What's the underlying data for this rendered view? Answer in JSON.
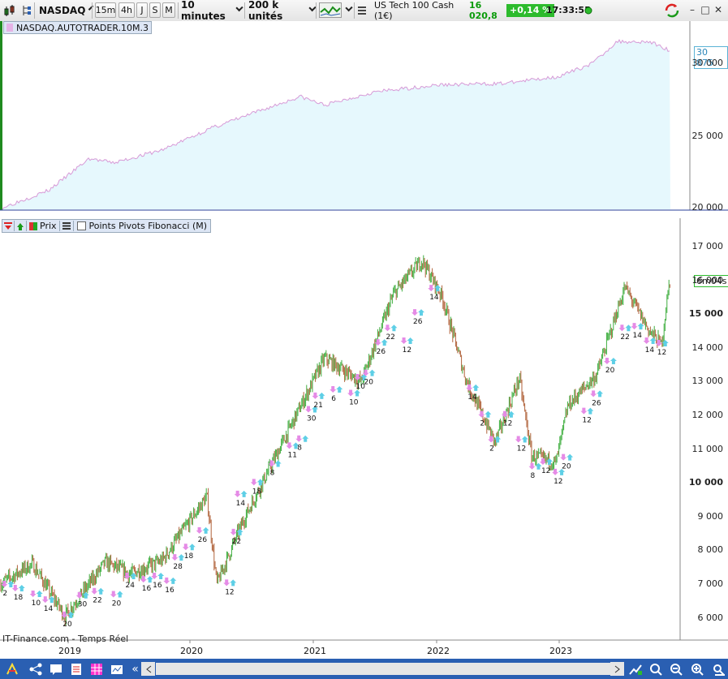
{
  "toolbar": {
    "instrument": "NASDAQ",
    "timeframes": [
      "15m",
      "4h",
      "J",
      "S",
      "M"
    ],
    "period": "10 minutes",
    "units": "200 k unités",
    "quote_name": "US Tech 100 Cash (1€)",
    "quote_price": "16 020,8",
    "quote_change": "+0,14 %",
    "time": "17:33:55",
    "colors": {
      "up": "#2dbb2d",
      "accent": "#2a5fb2"
    }
  },
  "top_panel": {
    "label": "NASDAQ.AUTOTRADER.10M.3",
    "last_value": "30 875",
    "y_ticks": [
      "30 000",
      "25 000",
      "20 000"
    ]
  },
  "main_panel": {
    "controls": {
      "prix": "Prix",
      "indicator": "Points Pivots Fibonacci (M)"
    },
    "countdown": "6m04s",
    "y_ticks": [
      "17 000",
      "16 000",
      "15 000",
      "14 000",
      "13 000",
      "12 000",
      "11 000",
      "10 000",
      "9 000",
      "8 000",
      "7 000",
      "6 000"
    ],
    "x_ticks": [
      "2019",
      "2020",
      "2021",
      "2022",
      "2023"
    ],
    "watermark": "IT-Finance.com - Temps Réel",
    "pivot_labels": [
      {
        "t": "2",
        "x": 0.02,
        "v": 6760
      },
      {
        "t": "18",
        "x": 0.1,
        "v": 6640
      },
      {
        "t": "10",
        "x": 0.23,
        "v": 6470
      },
      {
        "t": "14",
        "x": 0.32,
        "v": 6300
      },
      {
        "t": "20",
        "x": 0.46,
        "v": 5850
      },
      {
        "t": "30",
        "x": 0.57,
        "v": 6430
      },
      {
        "t": "22",
        "x": 0.68,
        "v": 6550
      },
      {
        "t": "20",
        "x": 0.82,
        "v": 6460
      },
      {
        "t": "24",
        "x": 0.92,
        "v": 7000
      },
      {
        "t": "16",
        "x": 1.04,
        "v": 6900
      },
      {
        "t": "16",
        "x": 1.12,
        "v": 7000
      },
      {
        "t": "16",
        "x": 1.21,
        "v": 6860
      },
      {
        "t": "28",
        "x": 1.27,
        "v": 7550
      },
      {
        "t": "18",
        "x": 1.35,
        "v": 7860
      },
      {
        "t": "26",
        "x": 1.45,
        "v": 8350
      },
      {
        "t": "12",
        "x": 1.65,
        "v": 6800
      },
      {
        "t": "22",
        "x": 1.7,
        "v": 8300
      },
      {
        "t": "14",
        "x": 1.73,
        "v": 9430
      },
      {
        "t": "18",
        "x": 1.85,
        "v": 9780
      },
      {
        "t": "8",
        "x": 1.98,
        "v": 10330
      },
      {
        "t": "11",
        "x": 2.11,
        "v": 10860
      },
      {
        "t": "8",
        "x": 2.18,
        "v": 11070
      },
      {
        "t": "30",
        "x": 2.25,
        "v": 11940
      },
      {
        "t": "21",
        "x": 2.3,
        "v": 12340
      },
      {
        "t": "6",
        "x": 2.43,
        "v": 12530
      },
      {
        "t": "10",
        "x": 2.56,
        "v": 12420
      },
      {
        "t": "10",
        "x": 2.61,
        "v": 12890
      },
      {
        "t": "20",
        "x": 2.67,
        "v": 13020
      },
      {
        "t": "26",
        "x": 2.76,
        "v": 13920
      },
      {
        "t": "22",
        "x": 2.83,
        "v": 14350
      },
      {
        "t": "12",
        "x": 2.95,
        "v": 13970
      },
      {
        "t": "26",
        "x": 3.03,
        "v": 14810
      },
      {
        "t": "14",
        "x": 3.15,
        "v": 15530
      },
      {
        "t": "14",
        "x": 3.43,
        "v": 12580
      },
      {
        "t": "2",
        "x": 3.52,
        "v": 11790
      },
      {
        "t": "2",
        "x": 3.59,
        "v": 11050
      },
      {
        "t": "12",
        "x": 3.69,
        "v": 11790
      },
      {
        "t": "12",
        "x": 3.79,
        "v": 11050
      },
      {
        "t": "8",
        "x": 3.89,
        "v": 10250
      },
      {
        "t": "12",
        "x": 3.97,
        "v": 10390
      },
      {
        "t": "12",
        "x": 4.06,
        "v": 10080
      },
      {
        "t": "20",
        "x": 4.12,
        "v": 10520
      },
      {
        "t": "12",
        "x": 4.27,
        "v": 11890
      },
      {
        "t": "26",
        "x": 4.34,
        "v": 12400
      },
      {
        "t": "20",
        "x": 4.44,
        "v": 13370
      },
      {
        "t": "22",
        "x": 4.55,
        "v": 14350
      },
      {
        "t": "14",
        "x": 4.64,
        "v": 14400
      },
      {
        "t": "14",
        "x": 4.73,
        "v": 13970
      },
      {
        "t": "12",
        "x": 4.82,
        "v": 13900
      }
    ]
  }
}
